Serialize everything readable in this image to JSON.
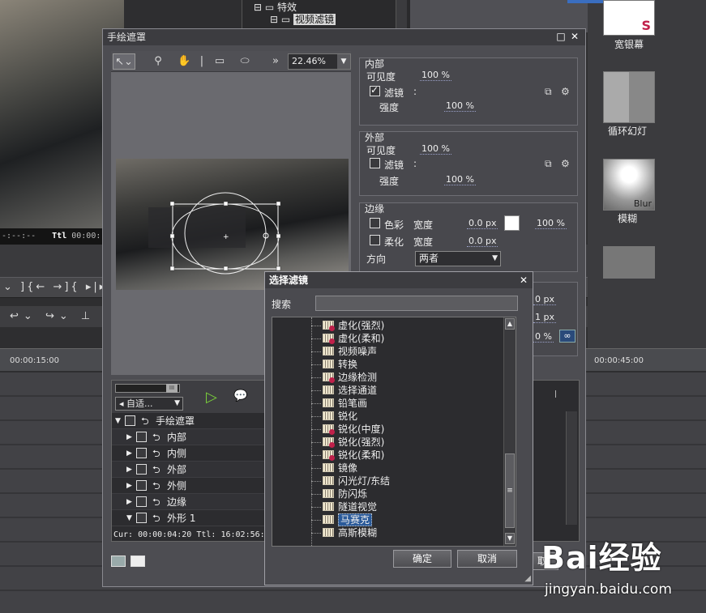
{
  "background": {
    "tree_items": [
      "特效",
      "视频滤镜"
    ],
    "timecode_left": "-:--:--",
    "timecode_ttl": "Ttl",
    "timecode_ttl_value": "00:00:",
    "ruler_marks": [
      "00:00:15:00",
      "00:00:45:00"
    ],
    "effect_thumbs": [
      "宽银幕",
      "循环幻灯",
      "模糊"
    ],
    "thumb_blur_text": "Blur",
    "right_label_partial": "取"
  },
  "main_dialog": {
    "title": "手绘遮罩",
    "zoom": "22.46%",
    "inner": {
      "title": "内部",
      "visibility_label": "可见度",
      "visibility_value": "100 %",
      "filter_label": "滤镜",
      "filter_checked": true,
      "filter_sep": ":",
      "strength_label": "强度",
      "strength_value": "100 %"
    },
    "outer": {
      "title": "外部",
      "visibility_label": "可见度",
      "visibility_value": "100 %",
      "filter_label": "滤镜",
      "filter_checked": false,
      "filter_sep": ":",
      "strength_label": "强度",
      "strength_value": "100 %"
    },
    "edge": {
      "title": "边缘",
      "color_label": "色彩",
      "width_label": "宽度",
      "color_width_value": "0.0 px",
      "color_pct": "100 %",
      "soft_label": "柔化",
      "soft_width_value": "0.0 px",
      "direction_label": "方向",
      "direction_value": "两者"
    },
    "partial_values": [
      "0 px",
      "1 px",
      "0 %"
    ],
    "layers": {
      "mode_select": "自适...",
      "rows": [
        {
          "name": "手绘遮罩",
          "indent": 0,
          "open": true
        },
        {
          "name": "内部",
          "indent": 1,
          "open": false
        },
        {
          "name": "内侧",
          "indent": 1,
          "open": false
        },
        {
          "name": "外部",
          "indent": 1,
          "open": false
        },
        {
          "name": "外侧",
          "indent": 1,
          "open": false
        },
        {
          "name": "边缘",
          "indent": 1,
          "open": false
        },
        {
          "name": "外形 1",
          "indent": 1,
          "open": true
        }
      ],
      "status_cur": "Cur: 00:00:04:20",
      "status_ttl": "Ttl: 16:02:56:"
    }
  },
  "select_dialog": {
    "title": "选择滤镜",
    "search_label": "搜索",
    "search_value": "",
    "items": [
      {
        "label": "虚化(强烈)",
        "red": true
      },
      {
        "label": "虚化(柔和)",
        "red": true
      },
      {
        "label": "视频噪声",
        "red": false
      },
      {
        "label": "转换",
        "red": false
      },
      {
        "label": "边缘检测",
        "red": true
      },
      {
        "label": "选择通道",
        "red": false
      },
      {
        "label": "铅笔画",
        "red": false
      },
      {
        "label": "锐化",
        "red": false
      },
      {
        "label": "锐化(中度)",
        "red": true
      },
      {
        "label": "锐化(强烈)",
        "red": true
      },
      {
        "label": "锐化(柔和)",
        "red": true
      },
      {
        "label": "镜像",
        "red": false
      },
      {
        "label": "闪光灯/东结",
        "red": false
      },
      {
        "label": "防闪烁",
        "red": false
      },
      {
        "label": "隧道视觉",
        "red": false
      },
      {
        "label": "马赛克",
        "red": false,
        "selected": true
      },
      {
        "label": "高斯模糊",
        "red": false
      }
    ],
    "ok_label": "确定",
    "cancel_label": "取消"
  },
  "watermark": {
    "logo": "Bai经验",
    "url": "jingyan.baidu.com"
  },
  "colors": {
    "selection": "#2a5a9a",
    "play_green": "#7ad03a"
  }
}
